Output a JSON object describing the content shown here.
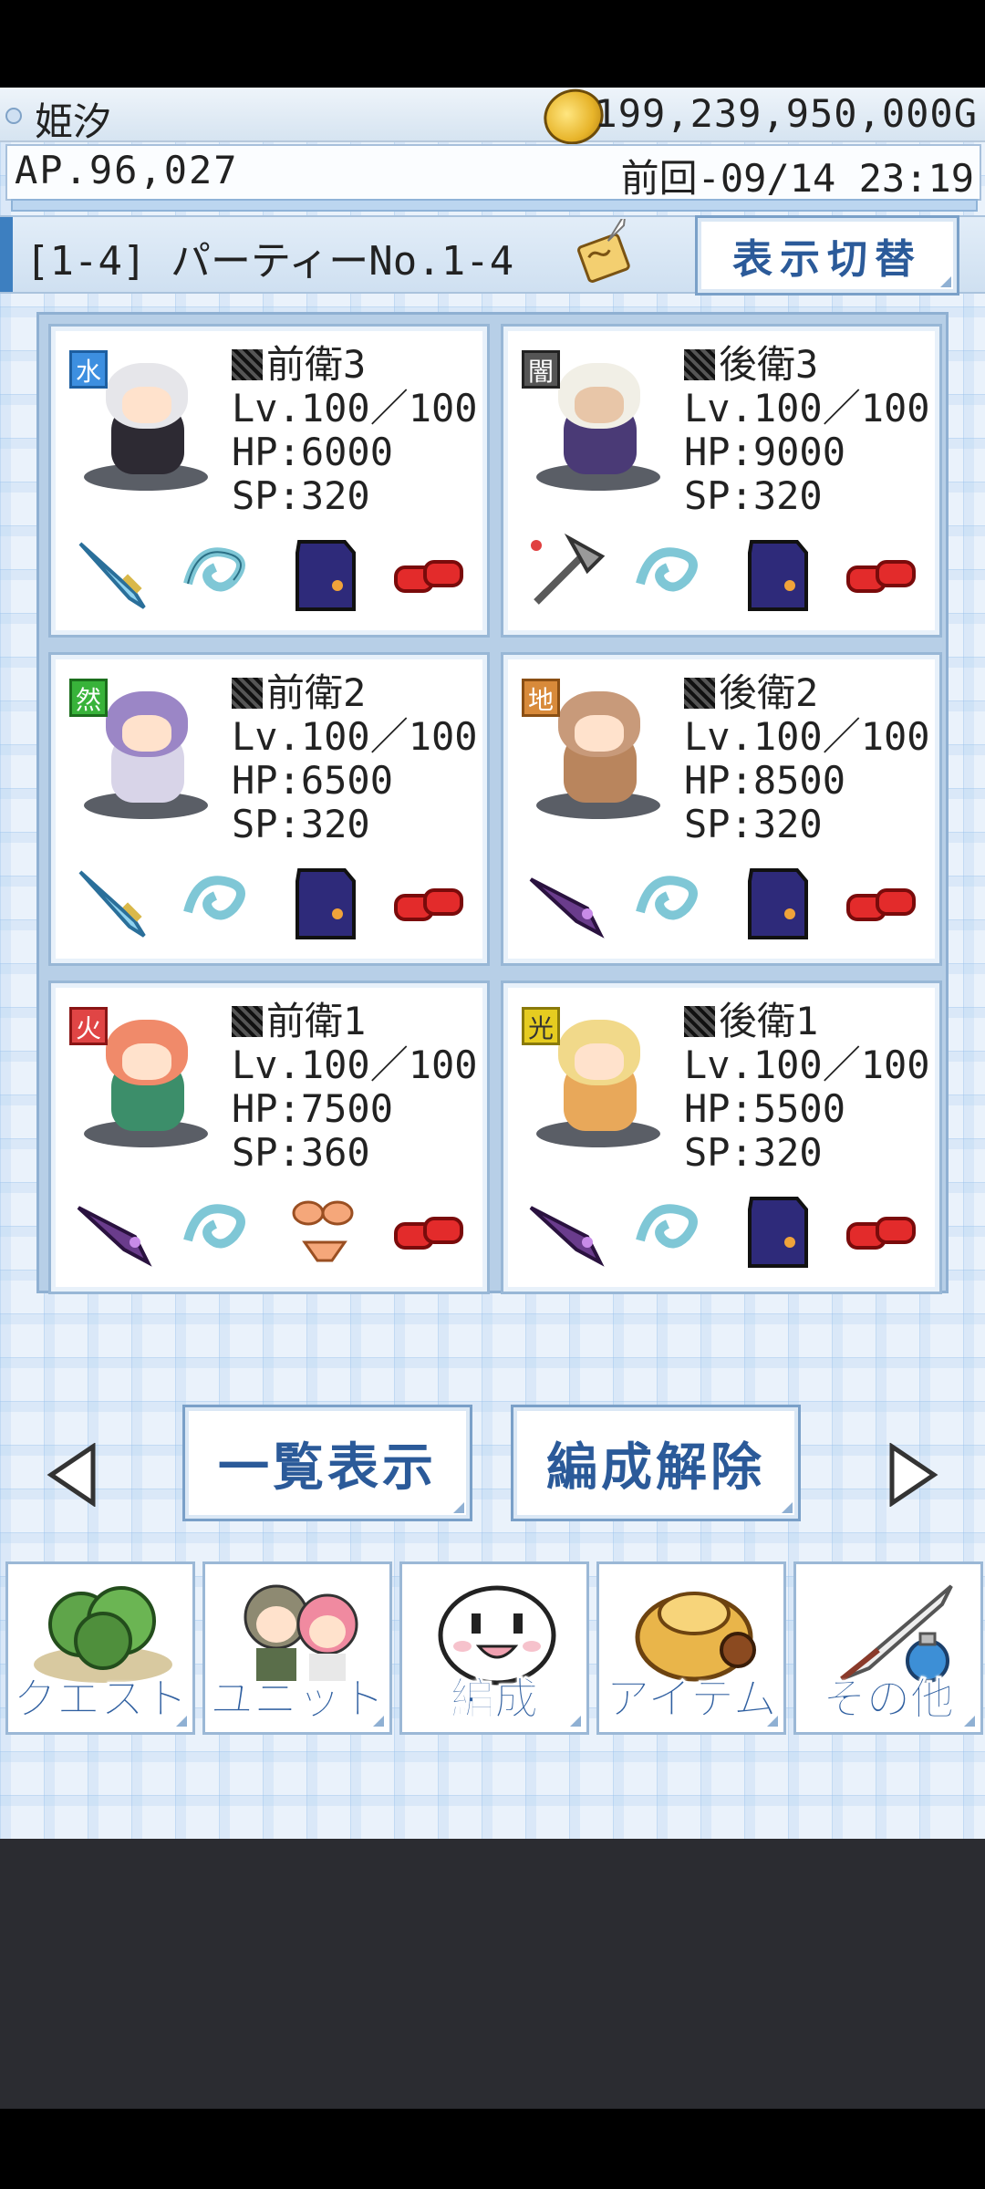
{
  "header": {
    "player_name": "姫汐",
    "gold": "199,239,950,000G",
    "ap": "AP.96,027",
    "last_login": "前回-09/14 23:19"
  },
  "party": {
    "name": "[1-4] パーティーNo.1-4",
    "switch_label": "表示切替"
  },
  "units": [
    {
      "element": "水",
      "element_color": "#3d8fe0",
      "position": "前衛3",
      "level": "Lv.100／100",
      "hp": "HP:6000",
      "sp": "SP:320"
    },
    {
      "element": "闇",
      "element_color": "#555555",
      "position": "後衛3",
      "level": "Lv.100／100",
      "hp": "HP:9000",
      "sp": "SP:320"
    },
    {
      "element": "然",
      "element_color": "#38b33a",
      "position": "前衛2",
      "level": "Lv.100／100",
      "hp": "HP:6500",
      "sp": "SP:320"
    },
    {
      "element": "地",
      "element_color": "#d88a3a",
      "position": "後衛2",
      "level": "Lv.100／100",
      "hp": "HP:8500",
      "sp": "SP:320"
    },
    {
      "element": "火",
      "element_color": "#e04545",
      "position": "前衛1",
      "level": "Lv.100／100",
      "hp": "HP:7500",
      "sp": "SP:360"
    },
    {
      "element": "光",
      "element_color": "#e6cc20",
      "position": "後衛1",
      "level": "Lv.100／100",
      "hp": "HP:5500",
      "sp": "SP:320"
    }
  ],
  "actions": {
    "list_label": "一覧表示",
    "release_label": "編成解除"
  },
  "menu": [
    {
      "label": "クエスト",
      "icon": "forest-icon"
    },
    {
      "label": "ユニット",
      "icon": "characters-icon"
    },
    {
      "label": "編成",
      "icon": "mascot-icon"
    },
    {
      "label": "アイテム",
      "icon": "bag-icon"
    },
    {
      "label": "その他",
      "icon": "quill-icon"
    }
  ]
}
